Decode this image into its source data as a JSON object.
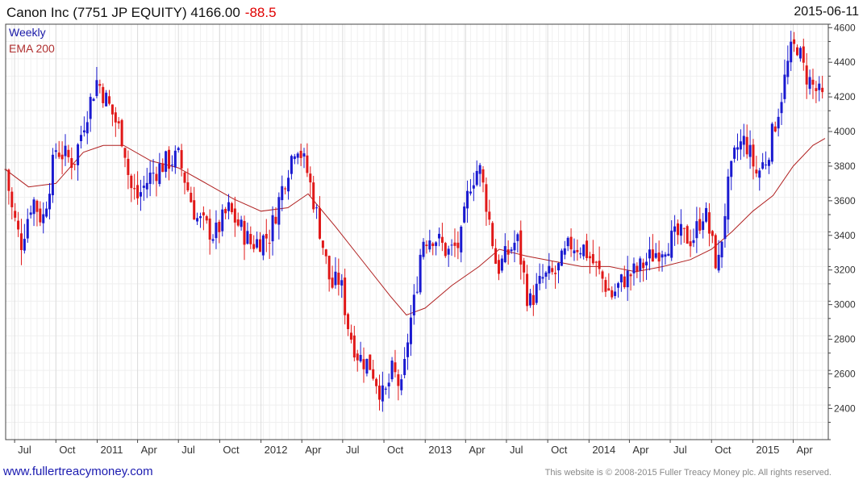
{
  "header": {
    "title": "Canon Inc (7751 JP EQUITY) 4166.00",
    "change": "-88.5",
    "date": "2015-06-11"
  },
  "legend": {
    "weekly": "Weekly",
    "ema": "EMA 200"
  },
  "footer": {
    "website": "www.fullertreacymoney.com",
    "copyright": "This website is © 2008-2015 Fuller Treacy Money plc. All rights reserved."
  },
  "colors": {
    "up": "#1a1ad0",
    "down": "#e01818",
    "ema": "#b02020",
    "grid": "#e6e6e6"
  },
  "chart_data": {
    "type": "candlestick",
    "frequency": "weekly",
    "x_range": [
      "2010-06-11",
      "2015-06-11"
    ],
    "ylim": [
      2220,
      4620
    ],
    "y_ticks": [
      2400,
      2600,
      2800,
      3000,
      3200,
      3400,
      3600,
      3800,
      4000,
      4200,
      4400,
      4600
    ],
    "x_ticks": [
      {
        "label": "Jul",
        "date": "2010-07-01"
      },
      {
        "label": "Oct",
        "date": "2010-10-01"
      },
      {
        "label": "2011",
        "date": "2011-01-01"
      },
      {
        "label": "Apr",
        "date": "2011-04-01"
      },
      {
        "label": "Jul",
        "date": "2011-07-01"
      },
      {
        "label": "Oct",
        "date": "2011-10-01"
      },
      {
        "label": "2012",
        "date": "2012-01-01"
      },
      {
        "label": "Apr",
        "date": "2012-04-01"
      },
      {
        "label": "Jul",
        "date": "2012-07-01"
      },
      {
        "label": "Oct",
        "date": "2012-10-01"
      },
      {
        "label": "2013",
        "date": "2013-01-01"
      },
      {
        "label": "Apr",
        "date": "2013-04-01"
      },
      {
        "label": "Jul",
        "date": "2013-07-01"
      },
      {
        "label": "Oct",
        "date": "2013-10-01"
      },
      {
        "label": "2014",
        "date": "2014-01-01"
      },
      {
        "label": "Apr",
        "date": "2014-04-01"
      },
      {
        "label": "Jul",
        "date": "2014-07-01"
      },
      {
        "label": "Oct",
        "date": "2014-10-01"
      },
      {
        "label": "2015",
        "date": "2015-01-01"
      },
      {
        "label": "Apr",
        "date": "2015-04-01"
      }
    ],
    "price_path": [
      {
        "date": "2010-06-11",
        "close": 3780
      },
      {
        "date": "2010-06-25",
        "close": 3550
      },
      {
        "date": "2010-07-15",
        "close": 3350
      },
      {
        "date": "2010-08-10",
        "close": 3620
      },
      {
        "date": "2010-09-01",
        "close": 3480
      },
      {
        "date": "2010-10-01",
        "close": 3900
      },
      {
        "date": "2010-11-10",
        "close": 3820
      },
      {
        "date": "2010-12-05",
        "close": 4080
      },
      {
        "date": "2011-01-01",
        "close": 4300
      },
      {
        "date": "2011-02-01",
        "close": 4120
      },
      {
        "date": "2011-03-01",
        "close": 3950
      },
      {
        "date": "2011-03-15",
        "close": 3680
      },
      {
        "date": "2011-04-01",
        "close": 3620
      },
      {
        "date": "2011-05-01",
        "close": 3750
      },
      {
        "date": "2011-06-01",
        "close": 3820
      },
      {
        "date": "2011-07-01",
        "close": 3850
      },
      {
        "date": "2011-08-10",
        "close": 3500
      },
      {
        "date": "2011-09-20",
        "close": 3400
      },
      {
        "date": "2011-10-20",
        "close": 3550
      },
      {
        "date": "2011-12-10",
        "close": 3350
      },
      {
        "date": "2012-01-20",
        "close": 3400
      },
      {
        "date": "2012-02-20",
        "close": 3700
      },
      {
        "date": "2012-03-20",
        "close": 3950
      },
      {
        "date": "2012-04-15",
        "close": 3750
      },
      {
        "date": "2012-05-10",
        "close": 3450
      },
      {
        "date": "2012-06-05",
        "close": 3100
      },
      {
        "date": "2012-06-25",
        "close": 3150
      },
      {
        "date": "2012-07-15",
        "close": 2850
      },
      {
        "date": "2012-08-05",
        "close": 2700
      },
      {
        "date": "2012-09-01",
        "close": 2650
      },
      {
        "date": "2012-10-01",
        "close": 2450
      },
      {
        "date": "2012-10-20",
        "close": 2620
      },
      {
        "date": "2012-11-10",
        "close": 2500
      },
      {
        "date": "2012-11-25",
        "close": 2850
      },
      {
        "date": "2012-12-10",
        "close": 3050
      },
      {
        "date": "2012-12-25",
        "close": 3380
      },
      {
        "date": "2013-01-20",
        "close": 3400
      },
      {
        "date": "2013-02-20",
        "close": 3300
      },
      {
        "date": "2013-03-20",
        "close": 3350
      },
      {
        "date": "2013-04-10",
        "close": 3700
      },
      {
        "date": "2013-05-01",
        "close": 3800
      },
      {
        "date": "2013-05-20",
        "close": 3550
      },
      {
        "date": "2013-06-10",
        "close": 3200
      },
      {
        "date": "2013-07-05",
        "close": 3300
      },
      {
        "date": "2013-07-25",
        "close": 3380
      },
      {
        "date": "2013-08-20",
        "close": 3000
      },
      {
        "date": "2013-09-20",
        "close": 3150
      },
      {
        "date": "2013-10-20",
        "close": 3180
      },
      {
        "date": "2013-11-20",
        "close": 3350
      },
      {
        "date": "2013-12-20",
        "close": 3330
      },
      {
        "date": "2014-01-20",
        "close": 3200
      },
      {
        "date": "2014-02-20",
        "close": 3050
      },
      {
        "date": "2014-03-20",
        "close": 3150
      },
      {
        "date": "2014-04-20",
        "close": 3200
      },
      {
        "date": "2014-05-20",
        "close": 3280
      },
      {
        "date": "2014-06-20",
        "close": 3350
      },
      {
        "date": "2014-07-20",
        "close": 3400
      },
      {
        "date": "2014-08-20",
        "close": 3380
      },
      {
        "date": "2014-09-15",
        "close": 3550
      },
      {
        "date": "2014-10-15",
        "close": 3200
      },
      {
        "date": "2014-11-05",
        "close": 3650
      },
      {
        "date": "2014-11-25",
        "close": 3900
      },
      {
        "date": "2014-12-15",
        "close": 3950
      },
      {
        "date": "2015-01-10",
        "close": 3750
      },
      {
        "date": "2015-02-01",
        "close": 3850
      },
      {
        "date": "2015-03-01",
        "close": 4150
      },
      {
        "date": "2015-03-25",
        "close": 4450
      },
      {
        "date": "2015-04-10",
        "close": 4500
      },
      {
        "date": "2015-04-25",
        "close": 4350
      },
      {
        "date": "2015-05-15",
        "close": 4260
      },
      {
        "date": "2015-06-11",
        "close": 4166
      }
    ],
    "ema200": [
      {
        "date": "2010-06-11",
        "value": 3780
      },
      {
        "date": "2010-08-01",
        "value": 3680
      },
      {
        "date": "2010-10-01",
        "value": 3700
      },
      {
        "date": "2010-12-01",
        "value": 3880
      },
      {
        "date": "2011-01-15",
        "value": 3920
      },
      {
        "date": "2011-03-01",
        "value": 3920
      },
      {
        "date": "2011-05-01",
        "value": 3830
      },
      {
        "date": "2011-07-01",
        "value": 3790
      },
      {
        "date": "2011-09-01",
        "value": 3700
      },
      {
        "date": "2011-11-01",
        "value": 3610
      },
      {
        "date": "2012-01-01",
        "value": 3540
      },
      {
        "date": "2012-03-01",
        "value": 3560
      },
      {
        "date": "2012-04-15",
        "value": 3640
      },
      {
        "date": "2012-06-15",
        "value": 3450
      },
      {
        "date": "2012-08-15",
        "value": 3250
      },
      {
        "date": "2012-10-15",
        "value": 3050
      },
      {
        "date": "2012-11-20",
        "value": 2940
      },
      {
        "date": "2013-01-01",
        "value": 2980
      },
      {
        "date": "2013-03-01",
        "value": 3110
      },
      {
        "date": "2013-05-01",
        "value": 3220
      },
      {
        "date": "2013-06-15",
        "value": 3320
      },
      {
        "date": "2013-08-15",
        "value": 3280
      },
      {
        "date": "2013-10-15",
        "value": 3250
      },
      {
        "date": "2013-12-15",
        "value": 3220
      },
      {
        "date": "2014-02-15",
        "value": 3220
      },
      {
        "date": "2014-04-15",
        "value": 3190
      },
      {
        "date": "2014-06-15",
        "value": 3220
      },
      {
        "date": "2014-08-15",
        "value": 3260
      },
      {
        "date": "2014-10-01",
        "value": 3320
      },
      {
        "date": "2014-11-15",
        "value": 3420
      },
      {
        "date": "2015-01-01",
        "value": 3540
      },
      {
        "date": "2015-02-15",
        "value": 3630
      },
      {
        "date": "2015-04-01",
        "value": 3800
      },
      {
        "date": "2015-05-15",
        "value": 3920
      },
      {
        "date": "2015-06-11",
        "value": 3960
      }
    ]
  }
}
